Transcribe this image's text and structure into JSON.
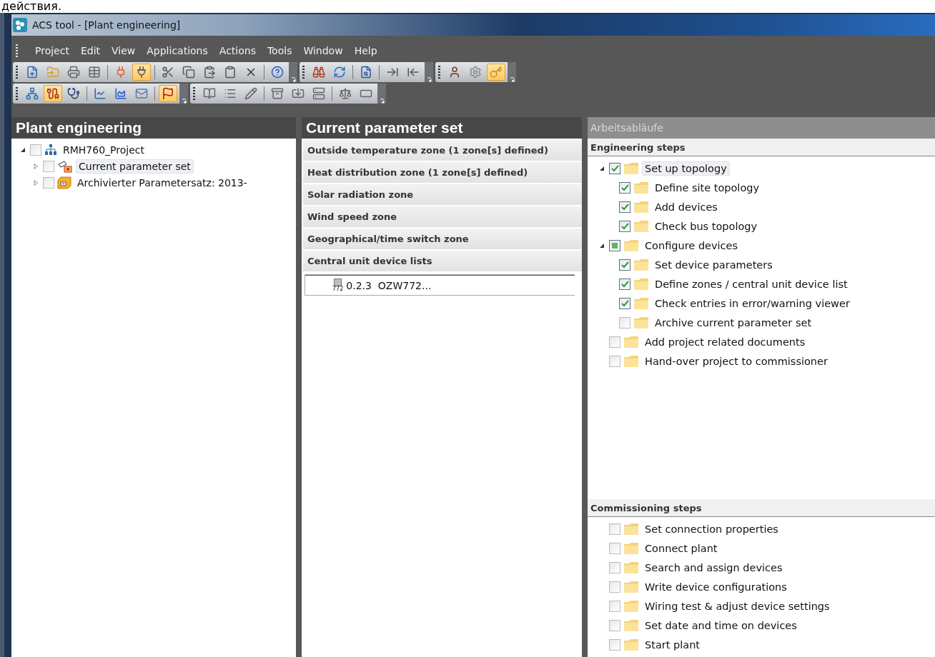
{
  "caption": "действия.",
  "window": {
    "title": "ACS tool - [Plant engineering]"
  },
  "menu": [
    "Project",
    "Edit",
    "View",
    "Applications",
    "Actions",
    "Tools",
    "Window",
    "Help"
  ],
  "toolbars": [
    [
      [
        {
          "on": false
        },
        {
          "on": false
        },
        {
          "on": false
        },
        {
          "on": false
        },
        {
          "on": false
        },
        {
          "on": true
        },
        {
          "on": false
        },
        {
          "on": false
        },
        {
          "on": false
        },
        {
          "on": false
        },
        {
          "on": false
        },
        {
          "on": false
        }
      ],
      [
        {
          "on": false
        },
        {
          "on": false
        },
        {
          "on": false
        },
        {
          "on": false
        },
        {
          "on": false
        }
      ],
      [
        {
          "on": false
        },
        {
          "on": false
        },
        {
          "on": true
        }
      ]
    ],
    [
      [
        {
          "on": false
        },
        {
          "on": true
        },
        {
          "on": false
        },
        {
          "on": false
        },
        {
          "on": false
        },
        {
          "on": false
        },
        {
          "on": true
        }
      ],
      [
        {
          "on": false
        },
        {
          "on": false
        },
        {
          "on": false
        },
        {
          "on": false
        },
        {
          "on": false
        },
        {
          "on": false
        },
        {
          "on": false
        },
        {
          "on": false
        }
      ]
    ]
  ],
  "plant_panel": {
    "title": "Plant engineering",
    "tree": [
      {
        "label": "RMH760_Project",
        "kind": "project",
        "checked": false,
        "selected": false,
        "expanded": true,
        "children": [
          {
            "label": "Current parameter set",
            "kind": "parameter-set",
            "checked": false,
            "selected": true,
            "expanded": false
          },
          {
            "label": "Archivierter Parametersatz: 2013-",
            "kind": "archive",
            "checked": false,
            "selected": false,
            "expanded": false
          }
        ]
      }
    ]
  },
  "parameter_panel": {
    "title": "Current parameter set",
    "zones": [
      {
        "label": "Outside temperature zone (1 zone[s] defined)"
      },
      {
        "label": "Heat distribution zone (1 zone[s] defined)"
      },
      {
        "label": "Solar radiation zone"
      },
      {
        "label": "Wind speed zone"
      },
      {
        "label": "Geographical/time switch zone"
      },
      {
        "label": "Central unit device lists",
        "items": [
          {
            "icon_text": "772",
            "label": "0.2.3  OZW772..."
          }
        ]
      }
    ]
  },
  "workflow_panel": {
    "title": "Arbeitsabläufe",
    "sections": [
      {
        "title": "Engineering steps",
        "steps": [
          {
            "label": "Set up topology",
            "checked": true,
            "partial": false,
            "selected": true,
            "expanded": true,
            "children": [
              {
                "label": "Define site topology",
                "checked": true,
                "partial": false,
                "selected": false
              },
              {
                "label": "Add devices",
                "checked": true,
                "partial": false,
                "selected": false
              },
              {
                "label": "Check bus topology",
                "checked": true,
                "partial": false,
                "selected": false
              }
            ]
          },
          {
            "label": "Configure devices",
            "partial": true,
            "selected": false,
            "expanded": true,
            "children": [
              {
                "label": "Set device parameters",
                "checked": true,
                "partial": false,
                "selected": false
              },
              {
                "label": "Define zones / central unit device list",
                "checked": true,
                "partial": false,
                "selected": false
              },
              {
                "label": "Check entries in error/warning viewer",
                "checked": true,
                "partial": false,
                "selected": false
              },
              {
                "label": "Archive current parameter set",
                "checked": false,
                "partial": false,
                "selected": false
              }
            ]
          },
          {
            "label": "Add project related documents",
            "checked": false,
            "partial": false,
            "selected": false
          },
          {
            "label": "Hand-over project to commissioner",
            "checked": false,
            "partial": false,
            "selected": false
          }
        ]
      },
      {
        "title": "Commissioning steps",
        "steps": [
          {
            "label": "Set connection properties",
            "checked": false,
            "partial": false,
            "selected": false
          },
          {
            "label": "Connect plant",
            "checked": false,
            "partial": false,
            "selected": false
          },
          {
            "label": "Search and assign devices",
            "checked": false,
            "partial": false,
            "selected": false
          },
          {
            "label": "Write device configurations",
            "checked": false,
            "partial": false,
            "selected": false
          },
          {
            "label": "Wiring test & adjust device settings",
            "checked": false,
            "partial": false,
            "selected": false
          },
          {
            "label": "Set date and time on devices",
            "checked": false,
            "partial": false,
            "selected": false
          },
          {
            "label": "Start plant",
            "checked": false,
            "partial": false,
            "selected": false
          }
        ]
      }
    ]
  }
}
